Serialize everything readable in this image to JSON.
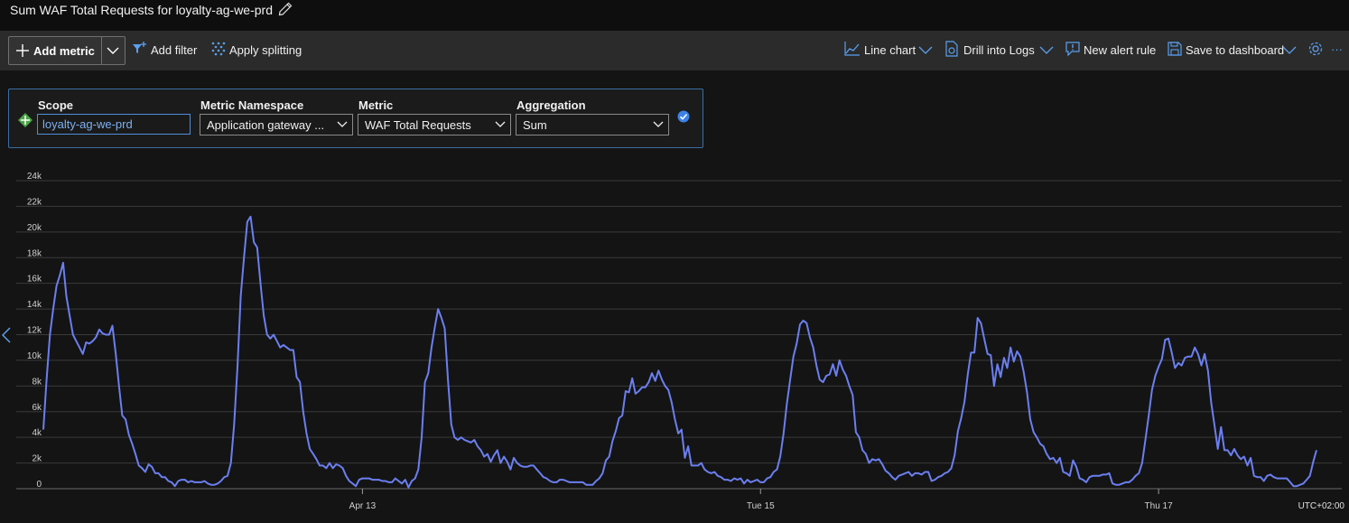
{
  "header": {
    "title": "Sum WAF Total Requests for loyalty-ag-we-prd"
  },
  "toolbar": {
    "add_metric_label": "Add metric",
    "add_filter_label": "Add filter",
    "apply_splitting_label": "Apply splitting",
    "line_chart_label": "Line chart",
    "drill_logs_label": "Drill into Logs",
    "new_alert_label": "New alert rule",
    "save_dashboard_label": "Save to dashboard",
    "more_label": "···"
  },
  "query": {
    "scope_label": "Scope",
    "scope_value": "loyalty-ag-we-prd",
    "namespace_label": "Metric Namespace",
    "namespace_value": "Application gateway ...",
    "metric_label": "Metric",
    "metric_value": "WAF Total Requests",
    "aggregation_label": "Aggregation",
    "aggregation_value": "Sum"
  },
  "chart_data": {
    "type": "line",
    "series": [
      {
        "name": "Sum WAF Total Requests for loyalty-ag-we-prd",
        "color": "#6b7ff0",
        "values": [
          4600,
          8500,
          12000,
          14000,
          15800,
          16600,
          17600,
          15000,
          13500,
          12000,
          11500,
          11000,
          10500,
          11400,
          11300,
          11500,
          11800,
          12400,
          12100,
          12000,
          12000,
          12700,
          10500,
          8000,
          5700,
          5400,
          4200,
          3500,
          2700,
          1800,
          1600,
          1300,
          1900,
          1700,
          1200,
          1200,
          900,
          900,
          600,
          500,
          200,
          600,
          700,
          700,
          500,
          600,
          500,
          500,
          500,
          600,
          400,
          300,
          300,
          400,
          600,
          900,
          1000,
          2000,
          5000,
          9500,
          15000,
          18000,
          20800,
          21200,
          19200,
          18800,
          16000,
          13500,
          12000,
          11700,
          12000,
          11500,
          11000,
          11200,
          11000,
          10800,
          10800,
          8700,
          8300,
          6000,
          4300,
          3100,
          2700,
          2300,
          1800,
          1800,
          1600,
          2000,
          1600,
          1900,
          1800,
          1600,
          1000,
          600,
          400,
          200,
          700,
          800,
          800,
          800,
          700,
          700,
          700,
          600,
          600,
          500,
          500,
          800,
          600,
          400,
          700,
          100,
          600,
          800,
          1500,
          4000,
          8300,
          9000,
          11000,
          12600,
          14000,
          13300,
          12500,
          8500,
          5000,
          4000,
          3800,
          4000,
          3800,
          3700,
          3600,
          3800,
          3300,
          3000,
          2500,
          2700,
          2100,
          2600,
          3000,
          2000,
          2500,
          2100,
          1500,
          2400,
          2000,
          1800,
          1700,
          1700,
          1800,
          1800,
          1500,
          1200,
          900,
          800,
          600,
          500,
          500,
          700,
          700,
          600,
          500,
          500,
          500,
          500,
          500,
          300,
          300,
          300,
          600,
          800,
          1200,
          2200,
          2500,
          3700,
          4500,
          5500,
          5700,
          7600,
          7500,
          8600,
          7400,
          7600,
          7900,
          7900,
          8300,
          9000,
          8400,
          9200,
          8500,
          8000,
          7700,
          6700,
          5400,
          4300,
          4600,
          2400,
          3300,
          1800,
          1800,
          1800,
          2000,
          1500,
          1300,
          1200,
          1300,
          1000,
          900,
          700,
          700,
          600,
          800,
          700,
          800,
          400,
          700,
          500,
          600,
          700,
          500,
          500,
          800,
          900,
          1300,
          1500,
          2500,
          4300,
          6600,
          8500,
          10300,
          11300,
          12800,
          13100,
          12900,
          11800,
          11000,
          9600,
          8500,
          8300,
          8800,
          8900,
          9700,
          8800,
          10000,
          9300,
          8800,
          8000,
          7300,
          4400,
          4000,
          3000,
          2700,
          2000,
          2300,
          2200,
          2300,
          1900,
          1400,
          1200,
          900,
          700,
          1000,
          1100,
          1200,
          1300,
          1000,
          1200,
          1200,
          1100,
          1300,
          1300,
          600,
          700,
          900,
          1000,
          1200,
          1300,
          1600,
          2600,
          4500,
          5500,
          6800,
          8900,
          10600,
          10600,
          13300,
          12900,
          11700,
          10500,
          10400,
          8000,
          9700,
          8700,
          10200,
          9400,
          11000,
          9900,
          10700,
          10300,
          9100,
          7500,
          5400,
          4400,
          4000,
          3500,
          3300,
          2700,
          2300,
          2400,
          2000,
          2400,
          1300,
          1200,
          1000,
          2200,
          1700,
          800,
          700,
          500,
          900,
          1000,
          1000,
          1000,
          1100,
          1100,
          1200,
          400,
          300,
          300,
          400,
          500,
          500,
          700,
          1000,
          1200,
          2000,
          3800,
          5700,
          7700,
          8800,
          9500,
          10100,
          11600,
          11700,
          10600,
          9400,
          9800,
          9600,
          10200,
          10300,
          10300,
          11000,
          10500,
          9600,
          10500,
          9200,
          6700,
          4900,
          3100,
          4800,
          3000,
          3000,
          2600,
          3100,
          2600,
          2300,
          2500,
          1800,
          2400,
          1000,
          900,
          900,
          600,
          1000,
          1100,
          900,
          800,
          800,
          800,
          800,
          500,
          200,
          200,
          300,
          400,
          700,
          1000,
          2100,
          3000
        ]
      }
    ],
    "y_ticks": [
      "0",
      "2k",
      "4k",
      "6k",
      "8k",
      "10k",
      "12k",
      "14k",
      "16k",
      "18k",
      "20k",
      "22k",
      "24k"
    ],
    "ylim": [
      0,
      24000
    ],
    "x_ticks": [
      {
        "label": "Apr 13",
        "index": 97
      },
      {
        "label": "Tue 15",
        "index": 218
      },
      {
        "label": "Thu 17",
        "index": 339
      }
    ],
    "timezone_label": "UTC+02:00",
    "grid": true
  }
}
